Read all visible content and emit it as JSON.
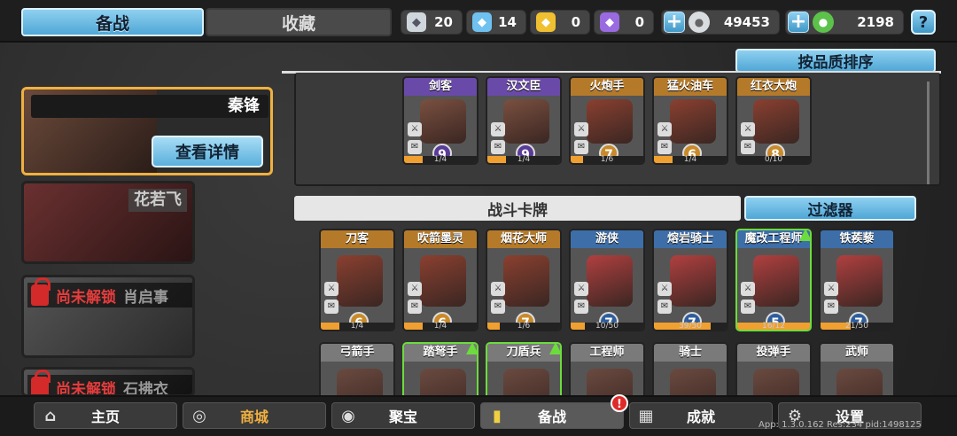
{
  "tabs": [
    {
      "label": "备战",
      "active": true
    },
    {
      "label": "收藏",
      "active": false
    }
  ],
  "resources": [
    {
      "icon": "silver-chest-icon",
      "value": "20",
      "color": "#cfd6dc"
    },
    {
      "icon": "blue-chest-icon",
      "value": "14",
      "color": "#6fc2f0"
    },
    {
      "icon": "gold-chest-icon",
      "value": "0",
      "color": "#f0c030"
    },
    {
      "icon": "purple-chest-icon",
      "value": "0",
      "color": "#9a6ae0"
    }
  ],
  "currency": [
    {
      "icon": "silver-coin-icon",
      "value": "49453"
    },
    {
      "icon": "green-gem-icon",
      "value": "2198"
    }
  ],
  "help_label": "?",
  "heroes": {
    "selected": {
      "name": "秦锋",
      "detail_label": "查看详情"
    },
    "list": [
      {
        "name": "花若飞",
        "locked": false
      },
      {
        "name": "肖启事",
        "locked": true,
        "lock_label": "尚未解锁"
      },
      {
        "name": "石拂衣",
        "locked": true,
        "lock_label": "尚未解锁"
      }
    ]
  },
  "sort_label": "按品质排序",
  "deck": [
    {
      "name": "剑客",
      "cost": "9",
      "progress": "1/4",
      "fill": 0.25,
      "rarity": "purple"
    },
    {
      "name": "汉文臣",
      "cost": "9",
      "progress": "1/4",
      "fill": 0.25,
      "rarity": "purple"
    },
    {
      "name": "火炮手",
      "cost": "7",
      "progress": "1/6",
      "fill": 0.17,
      "rarity": "orange"
    },
    {
      "name": "猛火油车",
      "cost": "6",
      "progress": "1/4",
      "fill": 0.25,
      "rarity": "orange"
    },
    {
      "name": "红衣大炮",
      "cost": "8",
      "progress": "0/10",
      "fill": 0,
      "rarity": "orange"
    }
  ],
  "section_title": "战斗卡牌",
  "filter_label": "过滤器",
  "cards_row1": [
    {
      "name": "刀客",
      "cost": "6",
      "progress": "1/4",
      "fill": 0.25,
      "rarity": "orange",
      "upgrade": false
    },
    {
      "name": "吹箭墨灵",
      "cost": "6",
      "progress": "1/4",
      "fill": 0.25,
      "rarity": "orange",
      "upgrade": false
    },
    {
      "name": "烟花大师",
      "cost": "7",
      "progress": "1/6",
      "fill": 0.17,
      "rarity": "orange",
      "upgrade": false
    },
    {
      "name": "游侠",
      "cost": "7",
      "progress": "10/50",
      "fill": 0.2,
      "rarity": "blue",
      "upgrade": false
    },
    {
      "name": "熔岩骑士",
      "cost": "7",
      "progress": "39/50",
      "fill": 0.78,
      "rarity": "blue",
      "upgrade": false
    },
    {
      "name": "魔改工程师",
      "cost": "5",
      "progress": "16/12",
      "fill": 1,
      "rarity": "blue",
      "upgrade": true
    },
    {
      "name": "铁蒺藜",
      "cost": "7",
      "progress": "21/50",
      "fill": 0.42,
      "rarity": "blue",
      "upgrade": false
    }
  ],
  "cards_row2": [
    {
      "name": "弓箭手",
      "rarity": "gray",
      "upgrade": false
    },
    {
      "name": "踏弩手",
      "rarity": "gray",
      "upgrade": true
    },
    {
      "name": "刀盾兵",
      "rarity": "gray",
      "upgrade": true
    },
    {
      "name": "工程师",
      "rarity": "gray",
      "upgrade": false
    },
    {
      "name": "骑士",
      "rarity": "gray",
      "upgrade": false
    },
    {
      "name": "投弹手",
      "rarity": "gray",
      "upgrade": false
    },
    {
      "name": "武师",
      "rarity": "gray",
      "upgrade": false
    }
  ],
  "nav": [
    {
      "label": "主页",
      "icon": "home-icon"
    },
    {
      "label": "商城",
      "icon": "shop-icon"
    },
    {
      "label": "聚宝",
      "icon": "treasure-icon"
    },
    {
      "label": "备战",
      "icon": "cards-icon",
      "badge": "!"
    },
    {
      "label": "成就",
      "icon": "achievement-icon"
    },
    {
      "label": "设置",
      "icon": "gear-icon"
    }
  ],
  "version": "App: 1.3.0.162 Res:234 pid:1498125"
}
